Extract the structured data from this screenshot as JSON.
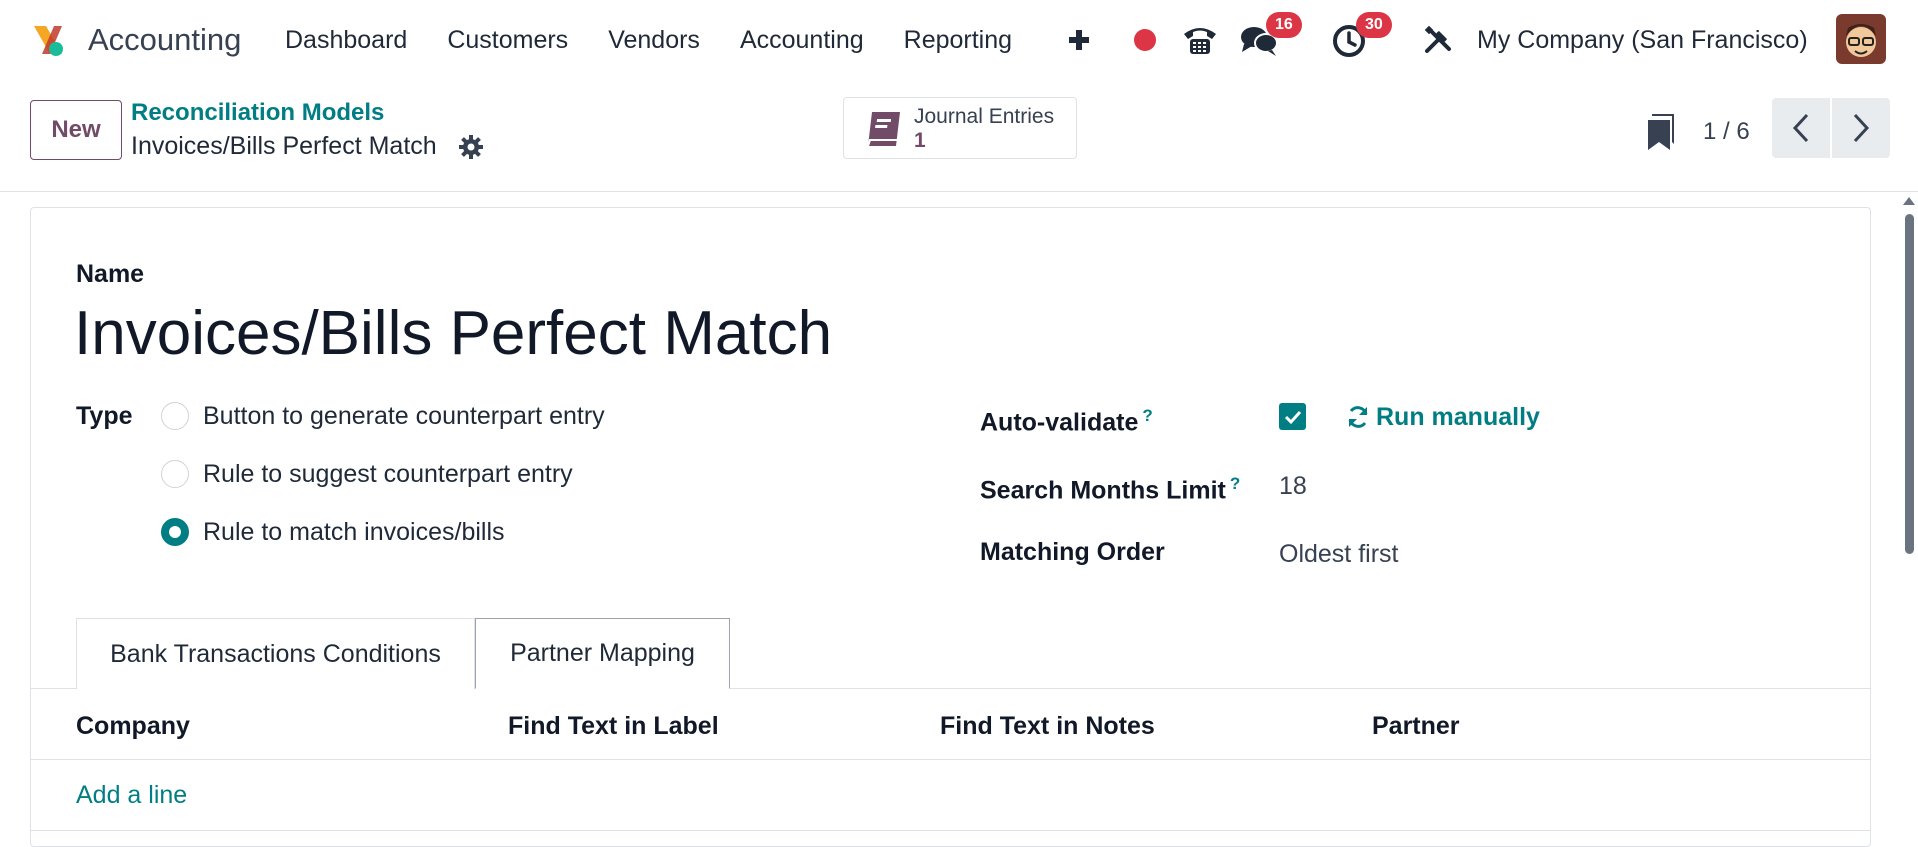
{
  "navbar": {
    "app_name": "Accounting",
    "menu": [
      "Dashboard",
      "Customers",
      "Vendors",
      "Accounting",
      "Reporting"
    ],
    "messages_badge": "16",
    "activities_badge": "30",
    "company": "My Company (San Francisco)",
    "icons": [
      "plus-icon",
      "record-icon",
      "phone-icon",
      "chat-icon",
      "clock-icon",
      "tools-icon"
    ]
  },
  "control": {
    "new_label": "New",
    "breadcrumb_parent": "Reconciliation Models",
    "breadcrumb_current": "Invoices/Bills Perfect Match",
    "smart_button_label": "Journal Entries",
    "smart_button_value": "1",
    "pager": "1 / 6"
  },
  "form": {
    "name_label": "Name",
    "name_value": "Invoices/Bills Perfect Match",
    "type_label": "Type",
    "type_options": [
      {
        "label": "Button to generate counterpart entry",
        "checked": false
      },
      {
        "label": "Rule to suggest counterpart entry",
        "checked": false
      },
      {
        "label": "Rule to match invoices/bills",
        "checked": true
      }
    ],
    "auto_validate_label": "Auto-validate",
    "auto_validate_checked": true,
    "run_manually_label": "Run manually",
    "search_months_label": "Search Months Limit",
    "search_months_value": "18",
    "matching_order_label": "Matching Order",
    "matching_order_value": "Oldest first",
    "help_mark": "?"
  },
  "notebook": {
    "tabs": [
      "Bank Transactions Conditions",
      "Partner Mapping"
    ],
    "active_tab": "Partner Mapping",
    "columns": [
      "Company",
      "Find Text in Label",
      "Find Text in Notes",
      "Partner"
    ],
    "add_line_label": "Add a line"
  },
  "colors": {
    "accent": "#017e84",
    "brand": "#714b67",
    "badge": "#dc3545"
  }
}
